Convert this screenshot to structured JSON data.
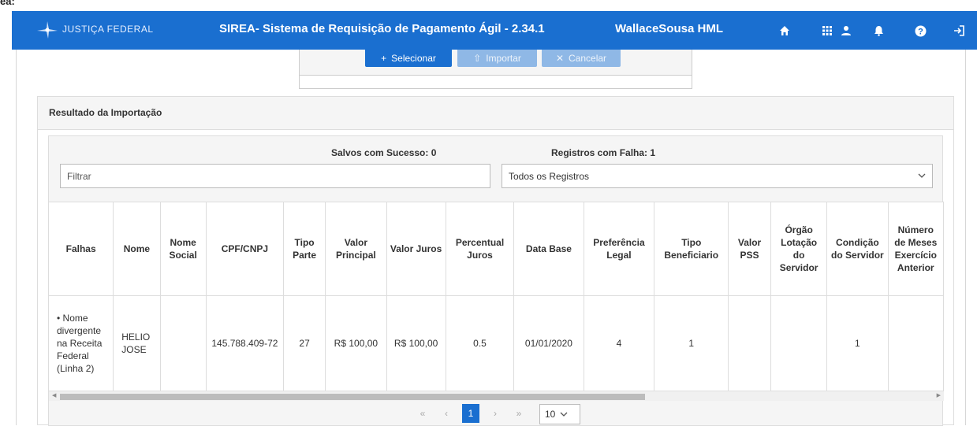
{
  "top_strip_text": "ea:",
  "header": {
    "logo_text": "JUSTIÇA FEDERAL",
    "app_title": "SIREA- Sistema de Requisição de Pagamento Ágil - 2.34.1",
    "user_name": "WallaceSousa HML",
    "color": "#1a6fd0",
    "icons": [
      "home-icon",
      "apps-grid-icon",
      "user-icon",
      "bell-icon",
      "help-icon",
      "logout-icon"
    ]
  },
  "upload": {
    "select_label": "Selecionar",
    "import_label": "Importar",
    "cancel_label": "Cancelar"
  },
  "result": {
    "panel_title": "Resultado da Importação",
    "saved_label": "Salvos com Sucesso: 0",
    "failed_label": "Registros com Falha: 1",
    "filter_placeholder": "Filtrar",
    "records_select": "Todos os Registros"
  },
  "table": {
    "columns": [
      "Falhas",
      "Nome",
      "Nome Social",
      "CPF/CNPJ",
      "Tipo Parte",
      "Valor Principal",
      "Valor Juros",
      "Percentual Juros",
      "Data Base",
      "Preferência Legal",
      "Tipo Beneficiario",
      "Valor PSS",
      "Órgão Lotação do Servidor",
      "Condição do Servidor",
      "Número de Meses Exercício Anterior"
    ],
    "rows": [
      {
        "falhas": "• Nome divergente na Receita Federal (Linha 2)",
        "nome": "HELIO JOSE",
        "nome_social": "",
        "cpf": "145.788.409-72",
        "tipo_parte": "27",
        "valor_principal": "R$ 100,00",
        "valor_juros": "R$ 100,00",
        "percentual_juros": "0.5",
        "data_base": "01/01/2020",
        "preferencia_legal": "4",
        "tipo_beneficiario": "1",
        "valor_pss": "",
        "orgao_lotacao": "",
        "condicao_servidor": "1",
        "numero_meses": ""
      }
    ]
  },
  "pagination": {
    "first": "«",
    "prev": "‹",
    "current_page": "1",
    "next": "›",
    "last": "»",
    "page_size": "10"
  }
}
